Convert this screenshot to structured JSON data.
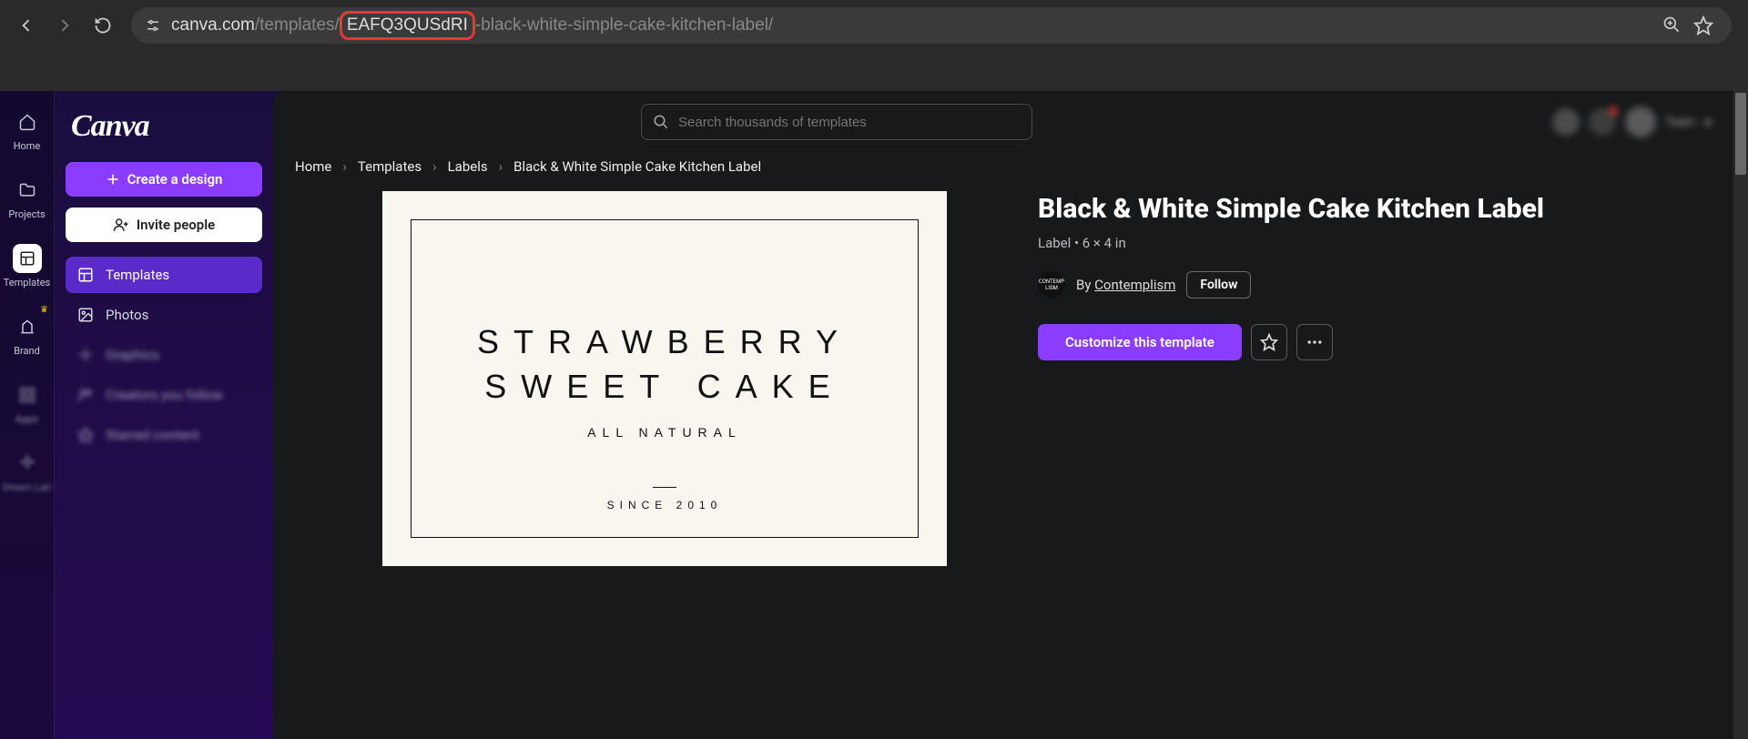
{
  "browser": {
    "url_domain": "canva.com",
    "url_path_prefix": "/templates/",
    "url_template_id": "EAFQ3QUSdRI",
    "url_path_suffix": "-black-white-simple-cake-kitchen-label/"
  },
  "rail": {
    "items": [
      {
        "label": "Home",
        "icon": "home"
      },
      {
        "label": "Projects",
        "icon": "folder"
      },
      {
        "label": "Templates",
        "icon": "templates",
        "active": true
      },
      {
        "label": "Brand",
        "icon": "brand",
        "crown": true
      },
      {
        "label": "Apps",
        "icon": "apps",
        "blur": true
      },
      {
        "label": "Dream Lab",
        "icon": "sparkle",
        "blur": true
      }
    ]
  },
  "sidebar": {
    "logo": "Canva",
    "create_label": "Create a design",
    "invite_label": "Invite people",
    "nav": [
      {
        "label": "Templates",
        "selected": true
      },
      {
        "label": "Photos"
      },
      {
        "label": "Graphics",
        "blur": true
      },
      {
        "label": "Creators you follow",
        "blur": true
      },
      {
        "label": "Starred content",
        "blur": true
      }
    ]
  },
  "search": {
    "placeholder": "Search thousands of templates"
  },
  "breadcrumbs": [
    "Home",
    "Templates",
    "Labels",
    "Black & White Simple Cake Kitchen Label"
  ],
  "template_preview": {
    "title_line1": "STRAWBERRY",
    "title_line2": "SWEET CAKE",
    "subtitle": "ALL NATURAL",
    "since": "SINCE 2010"
  },
  "info": {
    "title": "Black & White Simple Cake Kitchen Label",
    "meta": "Label • 6 × 4 in",
    "by_prefix": "By ",
    "author": "Contemplism",
    "follow": "Follow",
    "customize": "Customize this template"
  },
  "colors": {
    "accent": "#8b3dff",
    "url_highlight": "#e53935"
  }
}
